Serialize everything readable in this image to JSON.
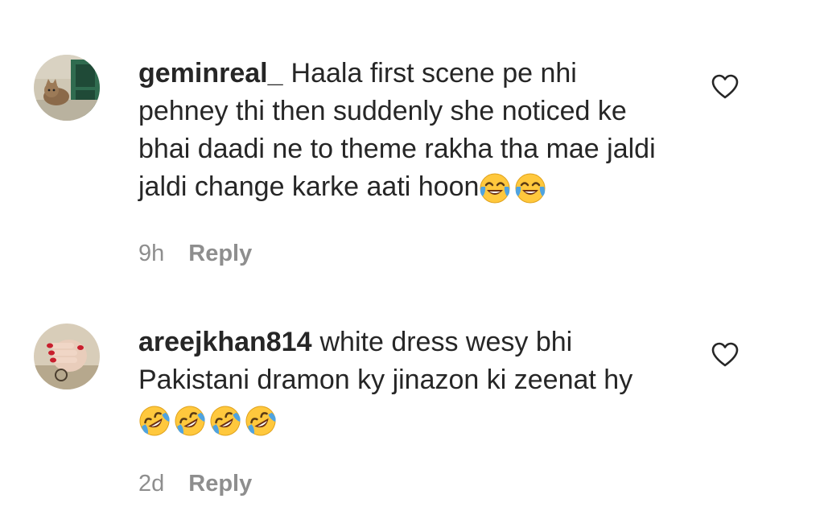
{
  "comments": [
    {
      "username": "geminreal_",
      "text": "Haala first scene pe nhi pehney thi then suddenly she noticed ke bhai daadi ne to theme rakha tha mae jaldi jaldi change karke aati hoon",
      "emojis": [
        "face-with-tears-of-joy",
        "face-with-tears-of-joy"
      ],
      "time": "9h",
      "reply_label": "Reply",
      "avatar": "cat-in-window-avatar"
    },
    {
      "username": "areejkhan814",
      "text": "white dress wesy bhi Pakistani dramon ky jinazon ki zeenat hy",
      "emojis": [
        "rolling-on-floor-laughing",
        "rolling-on-floor-laughing",
        "rolling-on-floor-laughing",
        "rolling-on-floor-laughing"
      ],
      "time": "2d",
      "reply_label": "Reply",
      "avatar": "hands-with-red-nails-avatar"
    }
  ],
  "colors": {
    "text": "#262626",
    "meta": "#8e8e8e",
    "emoji_face": "#FFC83D",
    "tears": "#4FA3E0"
  }
}
